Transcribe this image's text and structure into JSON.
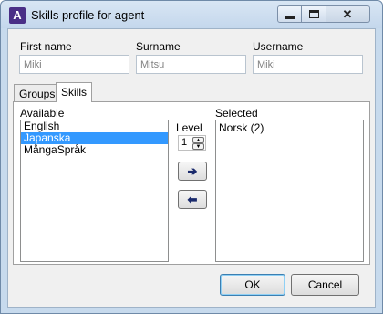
{
  "window": {
    "title": "Skills profile for agent",
    "app_icon_glyph": "A",
    "controls": {
      "minimize": "minimize-icon",
      "maximize": "maximize-icon",
      "close": "close-icon",
      "close_glyph": "✕"
    }
  },
  "fields": {
    "first_name": {
      "label": "First name",
      "value": "Miki"
    },
    "surname": {
      "label": "Surname",
      "value": "Mitsu"
    },
    "username": {
      "label": "Username",
      "value": "Miki"
    }
  },
  "tabs": [
    {
      "label": "Groups",
      "active": false
    },
    {
      "label": "Skills",
      "active": true
    }
  ],
  "skills": {
    "available_label": "Available",
    "available_items": [
      "English",
      "Japanska",
      "MångaSpråk"
    ],
    "available_selected_index": 1,
    "level_label": "Level",
    "level_value": "1",
    "add_glyph": "➔",
    "remove_glyph": "⬅",
    "selected_label": "Selected",
    "selected_items": [
      "Norsk (2)"
    ]
  },
  "buttons": {
    "ok": "OK",
    "cancel": "Cancel"
  },
  "colors": {
    "selection": "#3399ff",
    "title_bar": "#c7daed"
  }
}
